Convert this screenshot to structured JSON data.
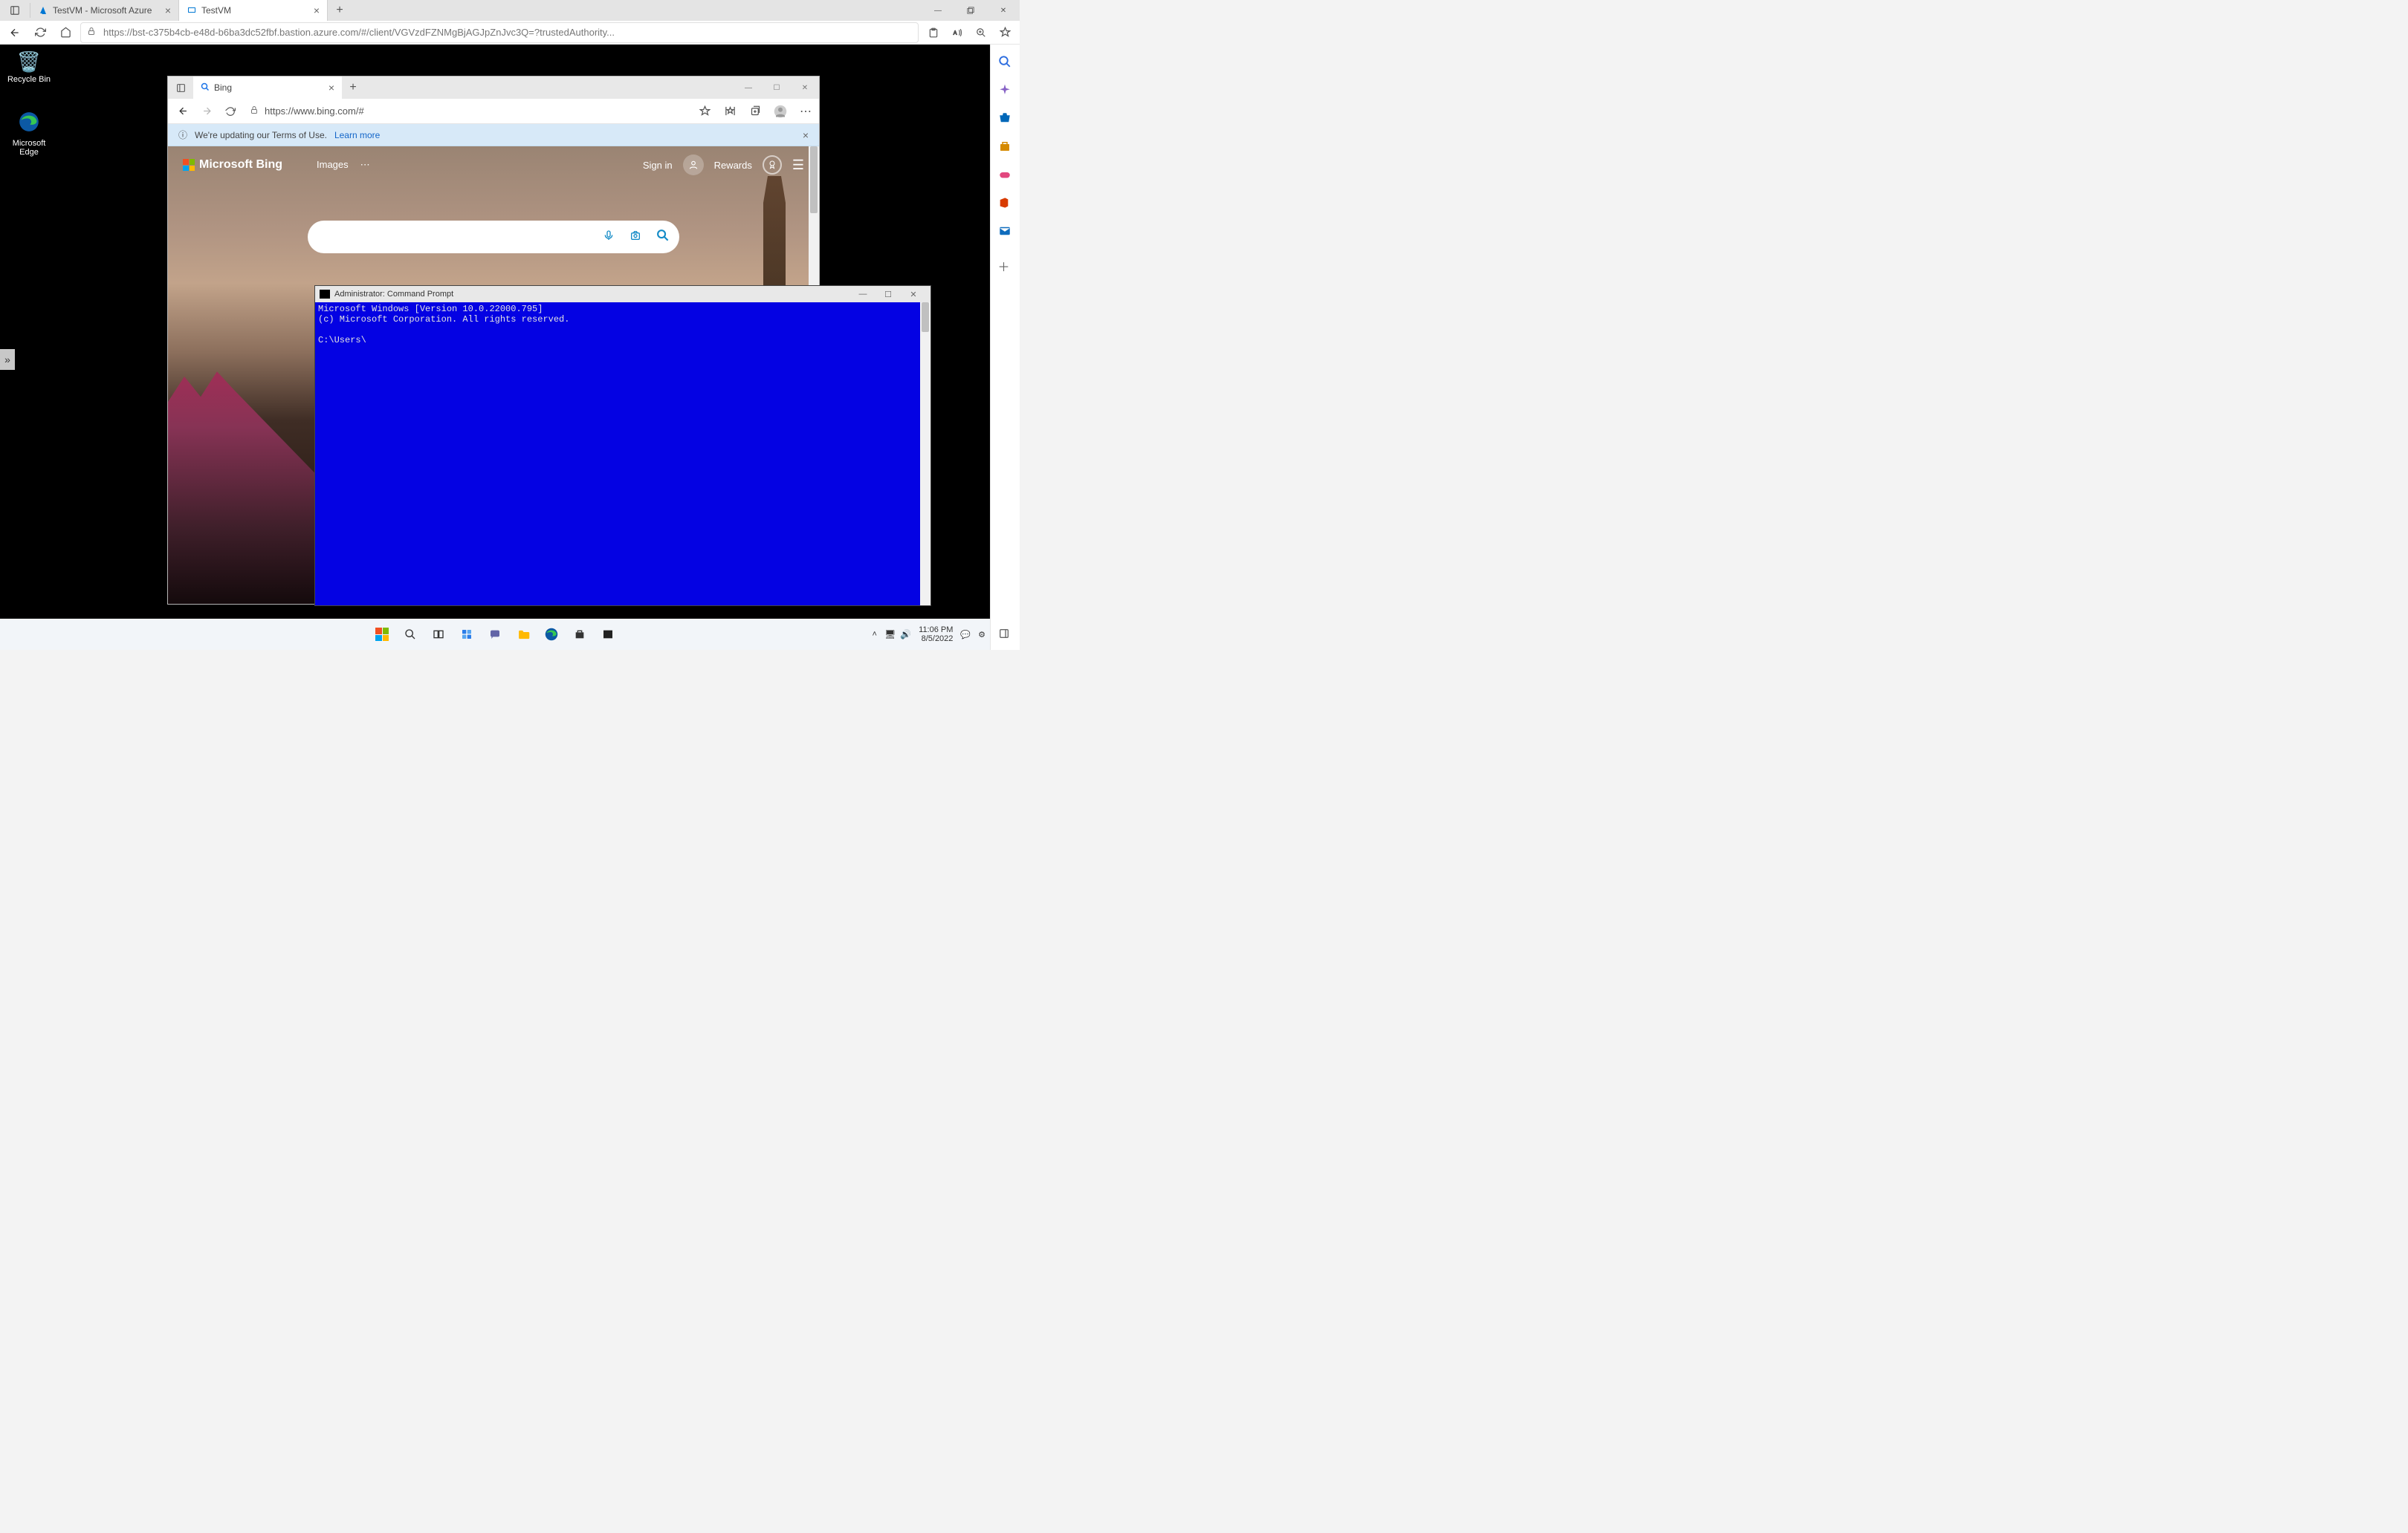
{
  "outer_browser": {
    "tabs": [
      {
        "title": "TestVM   - Microsoft Azure"
      },
      {
        "title": "TestVM"
      }
    ],
    "url": "https://bst-c375b4cb-e48d-b6ba3dc52fbf.bastion.azure.com/#/client/VGVzdFZNMgBjAGJpZnJvc3Q=?trustedAuthority..."
  },
  "remote": {
    "desktop_icons": {
      "recycle_bin": "Recycle Bin",
      "edge": "Microsoft Edge"
    },
    "taskbar": {
      "time": "11:06 PM",
      "date": "8/5/2022"
    }
  },
  "inner_browser": {
    "tab_title": "Bing",
    "url": "https://www.bing.com/#",
    "banner_text": "We're updating our Terms of Use.",
    "banner_link": "Learn more",
    "logo_text": "Microsoft Bing",
    "nav_images": "Images",
    "signin": "Sign in",
    "rewards": "Rewards"
  },
  "cmd": {
    "title": "Administrator: Command Prompt",
    "line1": "Microsoft Windows [Version 10.0.22000.795]",
    "line2": "(c) Microsoft Corporation. All rights reserved.",
    "prompt": "C:\\Users\\"
  }
}
